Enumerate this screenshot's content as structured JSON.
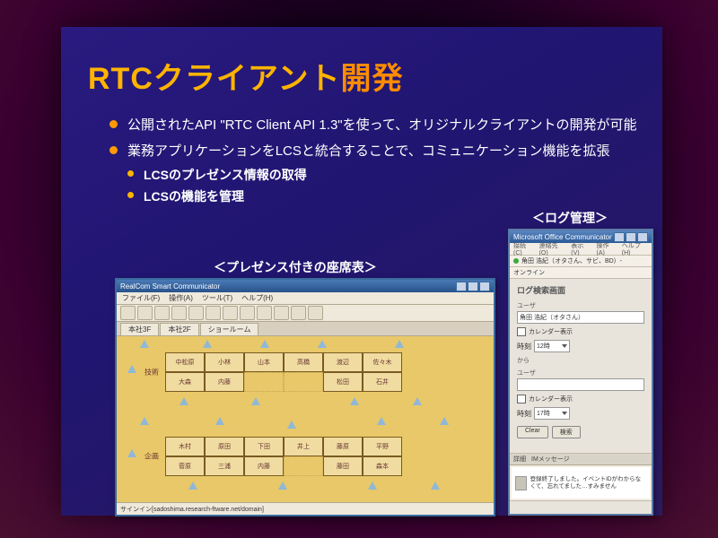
{
  "slide": {
    "title_prefix": "RTC",
    "title_mid": "クライアント",
    "title_suffix": "開発",
    "bullets": [
      "公開されたAPI \"RTC Client API 1.3\"を使って、オリジナルクライアントの開発が可能",
      "業務アプリケーションをLCSと統合することで、コミュニケーション機能を拡張"
    ],
    "sub_bullets": [
      "LCSのプレゼンス情報の取得",
      "LCSの機能を管理"
    ],
    "caption_seat": "＜プレゼンス付きの座席表＞",
    "caption_log": "＜ログ管理＞"
  },
  "seat_window": {
    "title": "RealCom Smart Communicator",
    "menus": [
      "ファイル(F)",
      "操作(A)",
      "ツール(T)",
      "ヘルプ(H)"
    ],
    "tabs": [
      "本社3F",
      "本社2F",
      "ショールーム"
    ],
    "group1_label": "技術",
    "group2_label": "企画",
    "group1_rows": [
      [
        "中松原",
        "小林",
        "山本",
        "高橋",
        "渡辺",
        "佐々木"
      ],
      [
        "大森",
        "内藤",
        "",
        "",
        "松田",
        "石井"
      ]
    ],
    "group2_rows": [
      [
        "木村",
        "原田",
        "下田",
        "井上",
        "藤原",
        "平野"
      ],
      [
        "菅原",
        "三浦",
        "内藤",
        "",
        "藤田",
        "森本"
      ]
    ],
    "status": "サインイン[sadoshima.research-ftware.net/domain]"
  },
  "log_window": {
    "title": "Microsoft Office Communicator",
    "menus": [
      "接続(C)",
      "連絡先(O)",
      "表示(V)",
      "操作(A)",
      "ヘルプ(H)"
    ],
    "status_text": "角田 浩紀（オタさん、サビ、BD）-",
    "online_text": "オンライン",
    "form_title": "ログ検索画面",
    "user_label": "ユーザ",
    "user_value": "角田 浩紀（オタさん）",
    "cal_check": "カレンダー表示",
    "time_label": "時刻",
    "time_value": "12時",
    "from_label": "から",
    "to_user_label": "ユーザ",
    "cal2_check": "カレンダー表示",
    "time2_label": "時刻",
    "time2_value": "17時",
    "btn_clear": "Clear",
    "btn_search": "検索",
    "list_head_time": "詳細",
    "list_head_msg": "IMメッセージ",
    "list_msg": "登録終了しました。イベントIDがわからなくて、忘れてました…すみません"
  }
}
